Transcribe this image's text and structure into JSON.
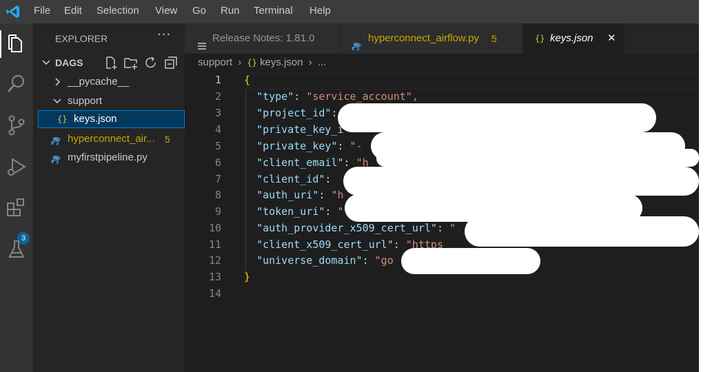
{
  "menu": [
    "File",
    "Edit",
    "Selection",
    "View",
    "Go",
    "Run",
    "Terminal",
    "Help"
  ],
  "activity": {
    "extensions_badge": "3"
  },
  "explorer": {
    "title": "EXPLORER",
    "more": "···",
    "folder": "DAGS",
    "items": [
      {
        "label": "__pycache__"
      },
      {
        "label": "support"
      },
      {
        "label": "keys.json"
      },
      {
        "label": "hyperconnect_air...",
        "badge": "5"
      },
      {
        "label": "myfirstpipeline.py"
      }
    ]
  },
  "tabs": [
    {
      "label": "Release Notes: 1.81.0"
    },
    {
      "label": "hyperconnect_airflow.py",
      "badge": "5"
    },
    {
      "label": "keys.json",
      "close": "✕"
    }
  ],
  "breadcrumb": {
    "folder": "support",
    "sep": "›",
    "file": "keys.json",
    "more": "..."
  },
  "editor": {
    "line_numbers": [
      "1",
      "2",
      "3",
      "4",
      "5",
      "6",
      "7",
      "8",
      "9",
      "10",
      "11",
      "12",
      "13",
      "14"
    ],
    "lines": [
      {
        "key": "",
        "rest": ""
      },
      {
        "key": "\"type\"",
        "rest": "\"service_account\","
      },
      {
        "key": "\"project_id\"",
        "rest": ""
      },
      {
        "key": "\"private_key_i",
        "rest": ""
      },
      {
        "key": "\"private_key\"",
        "rest": "\"-"
      },
      {
        "key": "\"client_email\"",
        "rest": "\"h"
      },
      {
        "key": "\"client_id\"",
        "rest": ""
      },
      {
        "key": "\"auth_uri\"",
        "rest": "\"h"
      },
      {
        "key": "\"token_uri\"",
        "rest": "\""
      },
      {
        "key": "\"auth_provider_x509_cert_url\"",
        "rest": "\""
      },
      {
        "key": "\"client_x509_cert_url\"",
        "rest": "\"https"
      },
      {
        "key": "\"universe_domain\"",
        "rest": "\"go"
      }
    ],
    "open_brace": "{",
    "close_brace": "}"
  },
  "colors": {
    "accent": "#007acc",
    "editor_bg": "#1e1e1e",
    "json_key": "#9cdcfe",
    "json_string": "#ce9178"
  }
}
